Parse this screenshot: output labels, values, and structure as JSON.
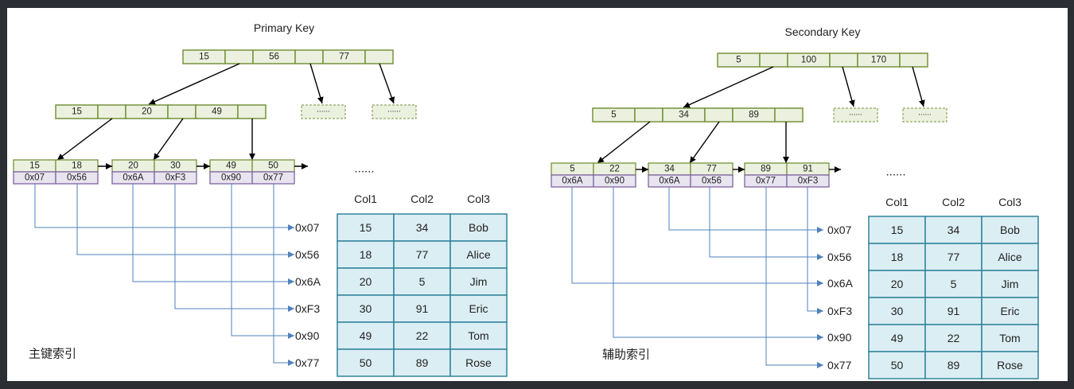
{
  "diagram": {
    "colors": {
      "node_fill": "#ebf1de",
      "node_stroke": "#76923c",
      "ptr_fill": "#e8e4f0",
      "ptr_stroke": "#8064a2",
      "line_blue": "#4f81bd",
      "table_fill": "#dbeef3",
      "table_stroke": "#31849b",
      "arrow_black": "#000000"
    },
    "primary": {
      "title": "Primary Key",
      "caption": "主键索引",
      "root": [
        "15",
        "",
        "56",
        "",
        "77",
        ""
      ],
      "mid": [
        "15",
        "",
        "20",
        "",
        "49",
        ""
      ],
      "ellipsis_box": "......",
      "leaves": [
        {
          "keys": [
            "15",
            "18"
          ],
          "ptrs": [
            "0x07",
            "0x56"
          ]
        },
        {
          "keys": [
            "20",
            "30"
          ],
          "ptrs": [
            "0x6A",
            "0xF3"
          ]
        },
        {
          "keys": [
            "49",
            "50"
          ],
          "ptrs": [
            "0x90",
            "0x77"
          ]
        }
      ],
      "leaf_ellipsis": "......",
      "addresses": [
        "0x07",
        "0x56",
        "0x6A",
        "0xF3",
        "0x90",
        "0x77"
      ]
    },
    "secondary": {
      "title": "Secondary Key",
      "caption": "辅助索引",
      "root": [
        "5",
        "",
        "100",
        "",
        "170",
        ""
      ],
      "mid": [
        "5",
        "",
        "34",
        "",
        "89",
        ""
      ],
      "ellipsis_box": "......",
      "leaves": [
        {
          "keys": [
            "5",
            "22"
          ],
          "ptrs": [
            "0x6A",
            "0x90"
          ]
        },
        {
          "keys": [
            "34",
            "77"
          ],
          "ptrs": [
            "0x6A",
            "0x56"
          ]
        },
        {
          "keys": [
            "89",
            "91"
          ],
          "ptrs": [
            "0x77",
            "0xF3"
          ]
        }
      ],
      "leaf_ellipsis": "......",
      "addresses": [
        "0x07",
        "0x56",
        "0x6A",
        "0xF3",
        "0x90",
        "0x77"
      ]
    },
    "table": {
      "columns": [
        "Col1",
        "Col2",
        "Col3"
      ],
      "rows": [
        [
          "15",
          "34",
          "Bob"
        ],
        [
          "18",
          "77",
          "Alice"
        ],
        [
          "20",
          "5",
          "Jim"
        ],
        [
          "30",
          "91",
          "Eric"
        ],
        [
          "49",
          "22",
          "Tom"
        ],
        [
          "50",
          "89",
          "Rose"
        ]
      ]
    }
  }
}
